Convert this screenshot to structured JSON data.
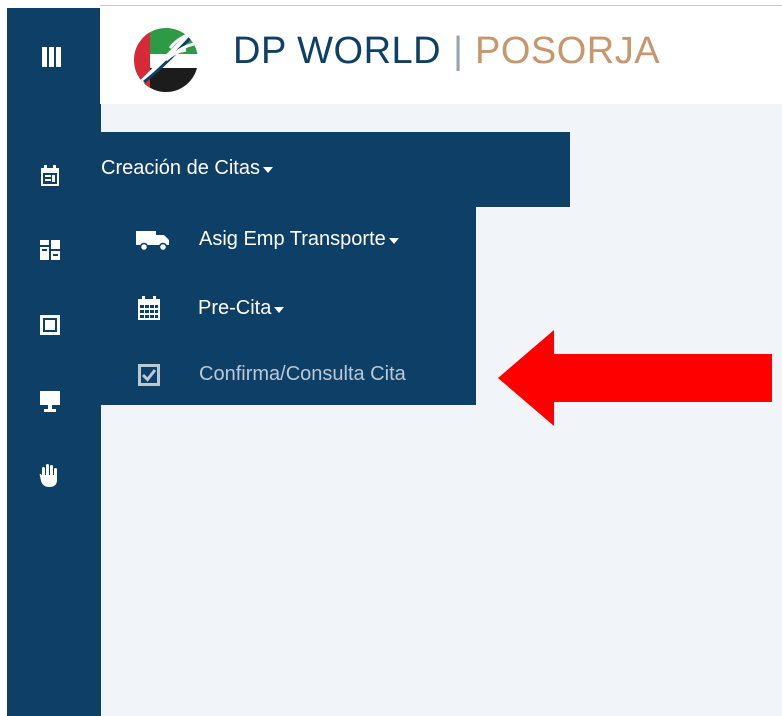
{
  "header": {
    "brand_primary": "DP WORLD",
    "brand_separator": "|",
    "brand_secondary": "POSORJA"
  },
  "sidebar": {
    "icons": [
      "menu-icon",
      "calendar-icon",
      "dashboard-icon",
      "window-icon",
      "monitor-icon",
      "hand-stop-icon"
    ]
  },
  "menu": {
    "main_label": "Creación de Citas",
    "items": [
      {
        "label": "Asig Emp Transporte",
        "icon": "truck-icon",
        "has_caret": true
      },
      {
        "label": "Pre-Cita",
        "icon": "calendar-grid-icon",
        "has_caret": true
      },
      {
        "label": "Confirma/Consulta Cita",
        "icon": "checkbox-icon",
        "has_caret": false
      }
    ]
  },
  "colors": {
    "navy": "#0e3f66",
    "brand_secondary": "#c9966b",
    "page_background": "#f1f4f9",
    "highlight_arrow": "#ff0000"
  }
}
